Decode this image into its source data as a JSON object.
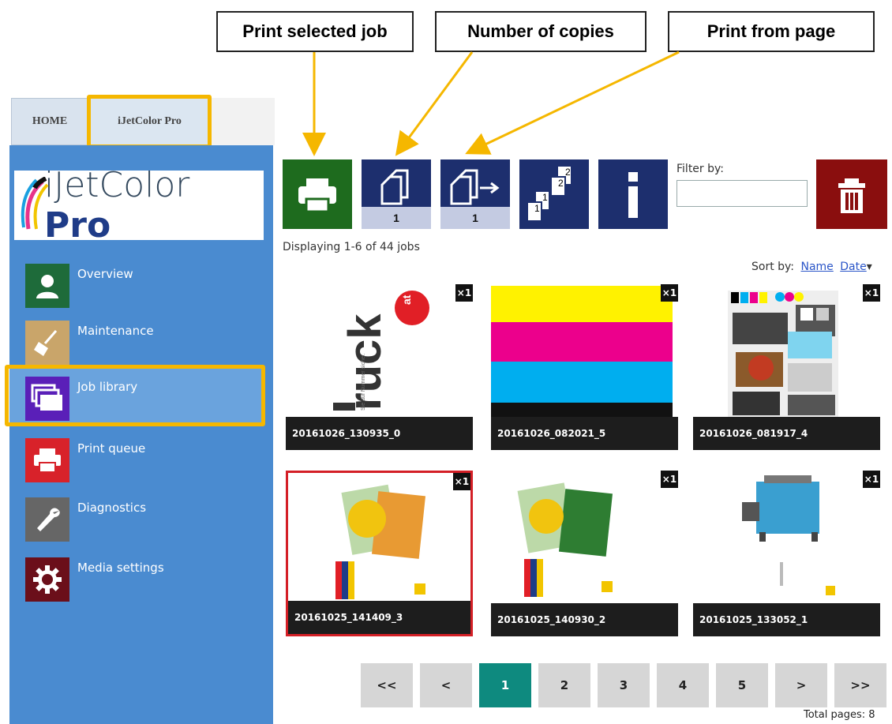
{
  "callouts": {
    "print_selected": "Print selected job",
    "copies": "Number of copies",
    "from_page": "Print from page"
  },
  "tabs": {
    "home": "HOME",
    "app": "iJetColor Pro"
  },
  "logo": {
    "text_main": "iJetColor",
    "text_pro": "Pro"
  },
  "sidebar": {
    "items": [
      {
        "label": "Overview",
        "icon": "person-icon",
        "color": "#1e6b3a"
      },
      {
        "label": "Maintenance",
        "icon": "broom-icon",
        "color": "#c9a56a"
      },
      {
        "label": "Job library",
        "icon": "stacked-pages-icon",
        "color": "#5a1fb8"
      },
      {
        "label": "Print queue",
        "icon": "printer-icon",
        "color": "#d8222a"
      },
      {
        "label": "Diagnostics",
        "icon": "wrench-icon",
        "color": "#666666"
      },
      {
        "label": "Media settings",
        "icon": "gear-icon",
        "color": "#6b0f1a"
      }
    ]
  },
  "toolbar": {
    "copies_value": "1",
    "from_page_value": "1",
    "filter_label": "Filter by:",
    "filter_value": ""
  },
  "status": {
    "displaying": "Displaying 1-6 of 44 jobs"
  },
  "sort": {
    "label": "Sort by:",
    "name": "Name",
    "date": "Date"
  },
  "jobs": [
    {
      "name": "20161026_130935_0",
      "copies": "×1",
      "brand": "ruck",
      "brand_badge": "at"
    },
    {
      "name": "20161026_082021_5",
      "copies": "×1"
    },
    {
      "name": "20161026_081917_4",
      "copies": "×1"
    },
    {
      "name": "20161025_141409_3",
      "copies": "×1",
      "selected": true
    },
    {
      "name": "20161025_140930_2",
      "copies": "×1"
    },
    {
      "name": "20161025_133052_1",
      "copies": "×1"
    }
  ],
  "pagination": {
    "first": "<<",
    "prev": "<",
    "pages": [
      "1",
      "2",
      "3",
      "4",
      "5"
    ],
    "next": ">",
    "last": ">>",
    "current": "1",
    "total": "Total pages: 8"
  },
  "colors": {
    "accent": "#f5b700",
    "sidebar": "#4a8bd0",
    "active_page": "#0e8a7f"
  }
}
